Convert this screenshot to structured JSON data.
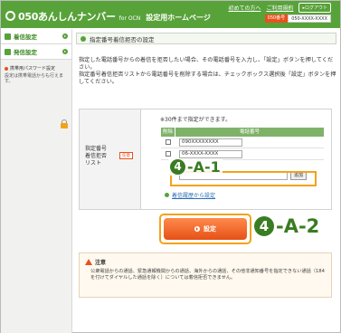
{
  "header": {
    "brand": "050あんしんナンバー",
    "brand_sub": "for OCN",
    "page_title": "設定用ホームページ",
    "top_links": [
      "初めての方へ",
      "ご利用規約"
    ],
    "logout": "ログアウト",
    "number_label": "050番号",
    "number_value": "050-XXXX-XXXX"
  },
  "sidebar": {
    "items": [
      {
        "label": "着信設定"
      },
      {
        "label": "発信設定"
      }
    ],
    "password_link": "携帯用パスワード設定",
    "password_note": "設定は携帯電話からも行えます。"
  },
  "main": {
    "section_title": "指定番号着信拒否の設定",
    "description": "指定した電話番号からの着信を拒否したい場合、その電話番号を入力し、「設定」ボタンを押してください。\n指定番号着信拒否リストから電話番号を削除する場合は、チェックボックス選択後「設定」ボタンを押してください。",
    "row_label": "指定番号\n着信拒否\nリスト",
    "required_badge": "任意",
    "max_note": "※30件まで指定ができます。",
    "table_headers": {
      "delete": "削除",
      "phone": "電話番号"
    },
    "rows": [
      {
        "phone": "090XXXXXXXX"
      },
      {
        "phone": "06-XXXX-XXXX"
      }
    ],
    "add_button": "追加",
    "history_link": "着信履歴から設定",
    "submit": "設定"
  },
  "annotations": {
    "a1_num": "4",
    "a1_text": "-A-1",
    "a2_num": "4",
    "a2_text": "-A-2"
  },
  "notice": {
    "title": "注意",
    "body": "公衆電話からの通話、緊急通報機関からの通話、海外からの通話、その他非通知番号を指定できない通話（184を付けてダイヤルした通話を除く）については着信拒否できません。"
  },
  "colors": {
    "brand_green": "#58a23a",
    "accent_orange": "#e9501e",
    "highlight": "#f2a31b"
  }
}
